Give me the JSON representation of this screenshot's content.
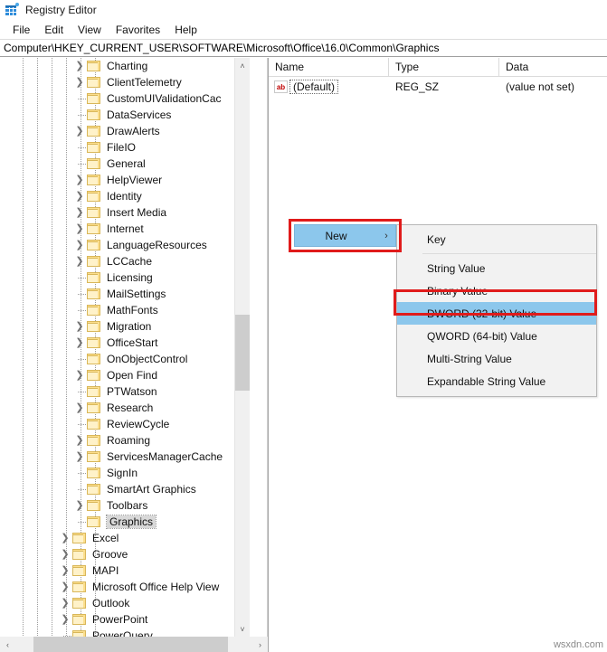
{
  "window": {
    "title": "Registry Editor",
    "icon": "registry-editor-icon"
  },
  "menubar": {
    "items": [
      {
        "label": "File"
      },
      {
        "label": "Edit"
      },
      {
        "label": "View"
      },
      {
        "label": "Favorites"
      },
      {
        "label": "Help"
      }
    ]
  },
  "address": {
    "path": "Computer\\HKEY_CURRENT_USER\\SOFTWARE\\Microsoft\\Office\\16.0\\Common\\Graphics"
  },
  "tree": {
    "items": [
      {
        "label": "Charting",
        "depth": 6,
        "expandable": true,
        "selected": false
      },
      {
        "label": "ClientTelemetry",
        "depth": 6,
        "expandable": true,
        "selected": false
      },
      {
        "label": "CustomUIValidationCac",
        "depth": 6,
        "expandable": false,
        "selected": false
      },
      {
        "label": "DataServices",
        "depth": 6,
        "expandable": false,
        "selected": false
      },
      {
        "label": "DrawAlerts",
        "depth": 6,
        "expandable": true,
        "selected": false
      },
      {
        "label": "FileIO",
        "depth": 6,
        "expandable": false,
        "selected": false
      },
      {
        "label": "General",
        "depth": 6,
        "expandable": false,
        "selected": false
      },
      {
        "label": "HelpViewer",
        "depth": 6,
        "expandable": true,
        "selected": false
      },
      {
        "label": "Identity",
        "depth": 6,
        "expandable": true,
        "selected": false
      },
      {
        "label": "Insert Media",
        "depth": 6,
        "expandable": true,
        "selected": false
      },
      {
        "label": "Internet",
        "depth": 6,
        "expandable": true,
        "selected": false
      },
      {
        "label": "LanguageResources",
        "depth": 6,
        "expandable": true,
        "selected": false
      },
      {
        "label": "LCCache",
        "depth": 6,
        "expandable": true,
        "selected": false
      },
      {
        "label": "Licensing",
        "depth": 6,
        "expandable": false,
        "selected": false
      },
      {
        "label": "MailSettings",
        "depth": 6,
        "expandable": false,
        "selected": false
      },
      {
        "label": "MathFonts",
        "depth": 6,
        "expandable": false,
        "selected": false
      },
      {
        "label": "Migration",
        "depth": 6,
        "expandable": true,
        "selected": false
      },
      {
        "label": "OfficeStart",
        "depth": 6,
        "expandable": true,
        "selected": false
      },
      {
        "label": "OnObjectControl",
        "depth": 6,
        "expandable": false,
        "selected": false
      },
      {
        "label": "Open Find",
        "depth": 6,
        "expandable": true,
        "selected": false
      },
      {
        "label": "PTWatson",
        "depth": 6,
        "expandable": false,
        "selected": false
      },
      {
        "label": "Research",
        "depth": 6,
        "expandable": true,
        "selected": false
      },
      {
        "label": "ReviewCycle",
        "depth": 6,
        "expandable": false,
        "selected": false
      },
      {
        "label": "Roaming",
        "depth": 6,
        "expandable": true,
        "selected": false
      },
      {
        "label": "ServicesManagerCache",
        "depth": 6,
        "expandable": true,
        "selected": false
      },
      {
        "label": "SignIn",
        "depth": 6,
        "expandable": false,
        "selected": false
      },
      {
        "label": "SmartArt Graphics",
        "depth": 6,
        "expandable": false,
        "selected": false
      },
      {
        "label": "Toolbars",
        "depth": 6,
        "expandable": true,
        "selected": false
      },
      {
        "label": "Graphics",
        "depth": 6,
        "expandable": false,
        "selected": true
      },
      {
        "label": "Excel",
        "depth": 5,
        "expandable": true,
        "selected": false
      },
      {
        "label": "Groove",
        "depth": 5,
        "expandable": true,
        "selected": false
      },
      {
        "label": "MAPI",
        "depth": 5,
        "expandable": true,
        "selected": false
      },
      {
        "label": "Microsoft Office Help View",
        "depth": 5,
        "expandable": true,
        "selected": false
      },
      {
        "label": "Outlook",
        "depth": 5,
        "expandable": true,
        "selected": false
      },
      {
        "label": "PowerPoint",
        "depth": 5,
        "expandable": true,
        "selected": false
      },
      {
        "label": "PowerQuery",
        "depth": 5,
        "expandable": false,
        "selected": false
      }
    ]
  },
  "values": {
    "columns": {
      "name": "Name",
      "type": "Type",
      "data": "Data"
    },
    "rows": [
      {
        "icon": "string-value-icon",
        "icon_text": "ab",
        "name": "(Default)",
        "type": "REG_SZ",
        "data": "(value not set)"
      }
    ]
  },
  "context_menu": {
    "parent_item": {
      "label": "New",
      "submenu_arrow": "›",
      "highlighted": true
    },
    "submenu": [
      {
        "label": "Key",
        "highlighted": false
      },
      {
        "label": "String Value",
        "highlighted": false
      },
      {
        "label": "Binary Value",
        "highlighted": false
      },
      {
        "label": "DWORD (32-bit) Value",
        "highlighted": true
      },
      {
        "label": "QWORD (64-bit) Value",
        "highlighted": false
      },
      {
        "label": "Multi-String Value",
        "highlighted": false
      },
      {
        "label": "Expandable String Value",
        "highlighted": false
      }
    ]
  },
  "annotations": {
    "highlight_color": "#e01b1b",
    "selection_color": "#8cc7ec",
    "boxes": [
      {
        "target": "New",
        "color": "#e01b1b"
      },
      {
        "target": "DWORD (32-bit) Value",
        "color": "#e01b1b"
      }
    ]
  },
  "scrollbars": {
    "tree_vertical_up": "˄",
    "tree_vertical_down": "˅",
    "tree_horizontal_left": "‹",
    "tree_horizontal_right": "›"
  },
  "watermark": {
    "text": "wsxdn.com"
  }
}
